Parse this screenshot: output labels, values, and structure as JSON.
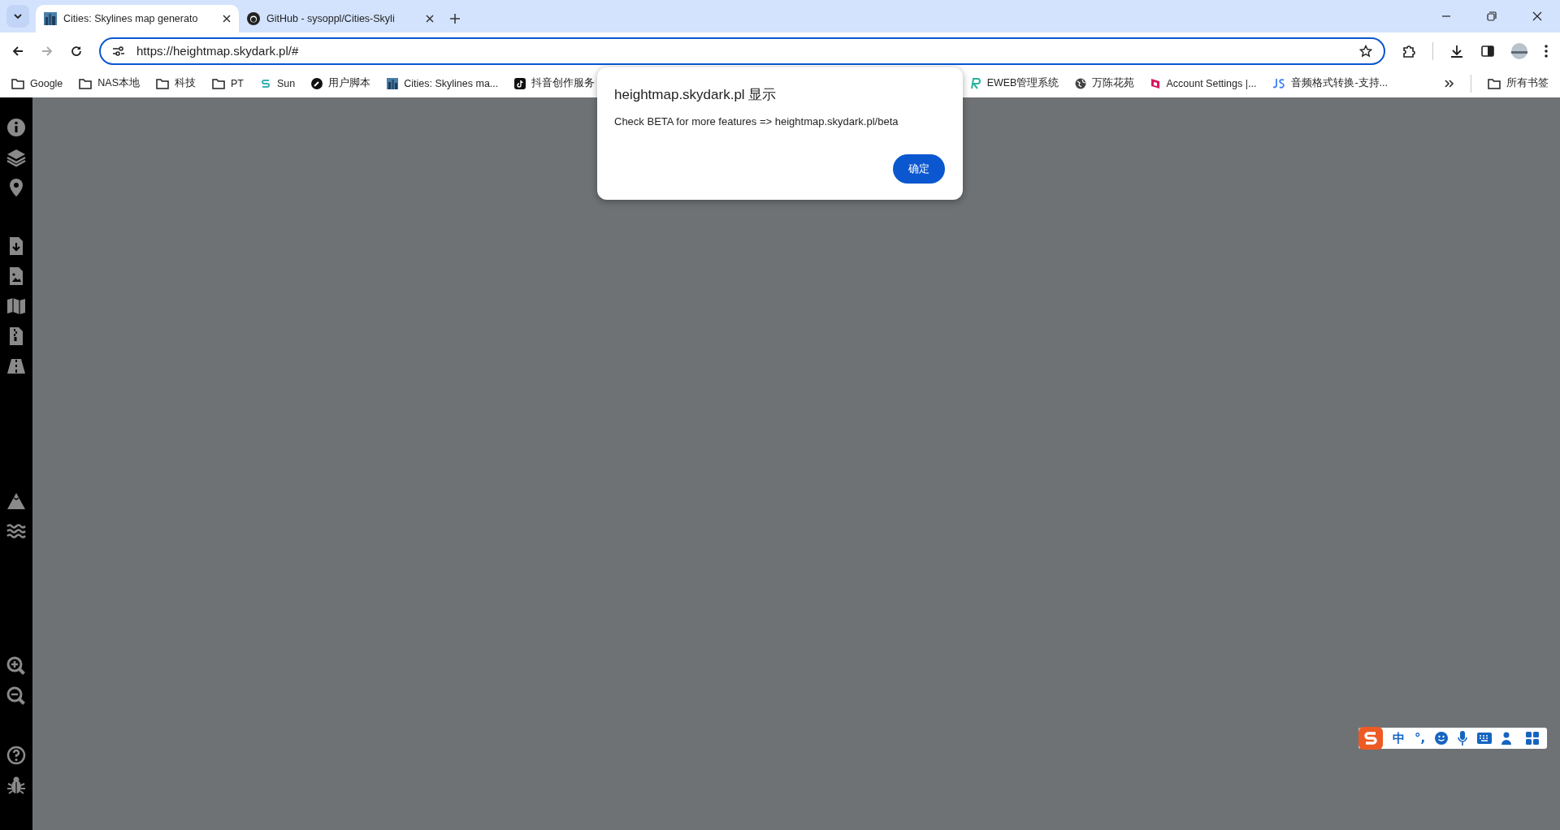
{
  "tabs": [
    {
      "title": "Cities: Skylines map generato",
      "selected": true,
      "kind": "city"
    },
    {
      "title": "GitHub - sysoppl/Cities-Skyli",
      "selected": false,
      "kind": "github"
    }
  ],
  "address": {
    "url": "https://heightmap.skydark.pl/#"
  },
  "bookmarks": [
    {
      "label": "Google",
      "kind": "folder"
    },
    {
      "label": "NAS本地",
      "kind": "folder"
    },
    {
      "label": "科技",
      "kind": "folder"
    },
    {
      "label": "PT",
      "kind": "folder"
    },
    {
      "label": "Sun",
      "kind": "s"
    },
    {
      "label": "用户脚本",
      "kind": "script"
    },
    {
      "label": "Cities: Skylines ma...",
      "kind": "city"
    },
    {
      "label": "抖音创作服务",
      "kind": "tiktok"
    },
    {
      "label": "EWEB管理系统",
      "kind": "r"
    },
    {
      "label": "万陈花苑",
      "kind": "globe"
    },
    {
      "label": "Account Settings |...",
      "kind": "account"
    },
    {
      "label": "音频格式转换-支持...",
      "kind": "js"
    }
  ],
  "all_bookmarks": "所有书签",
  "dialog": {
    "title": "heightmap.skydark.pl 显示",
    "message": "Check BETA for more features => heightmap.skydark.pl/beta",
    "button": "确定"
  },
  "ime": {
    "mode": "中",
    "punct": "°,"
  }
}
